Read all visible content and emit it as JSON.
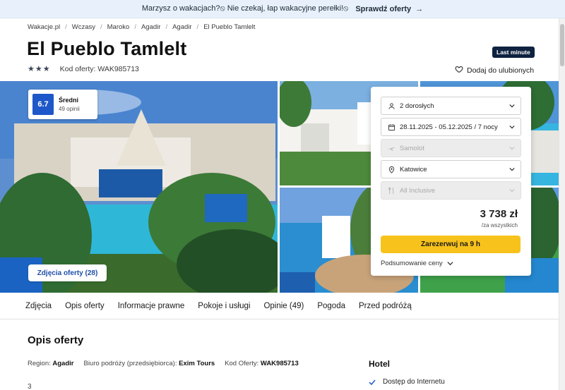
{
  "promo": {
    "text": "Marzysz o wakacjach?⦸ Nie czekaj, łap wakacyjne perełki!⦸",
    "cta": "Sprawdź oferty"
  },
  "breadcrumb": [
    "Wakacje.pl",
    "Wczasy",
    "Maroko",
    "Agadir",
    "Agadir",
    "El Pueblo Tamlelt"
  ],
  "hotel": {
    "name": "El Pueblo Tamlelt",
    "badge": "Last minute",
    "stars": 3,
    "offer_code_label": "Kod oferty: WAK985713",
    "favorite_label": "Dodaj do ulubionych"
  },
  "score": {
    "value": "6.7",
    "label": "Średni",
    "reviews": "49 opinii"
  },
  "photos_button": "Zdjęcia oferty (28)",
  "booking": {
    "travelers": "2 dorosłych",
    "dates": "28.11.2025 - 05.12.2025 / 7 nocy",
    "transport": "Samolot",
    "departure": "Katowice",
    "board": "All Inclusive",
    "price": "3 738 zł",
    "per": "/za wszystkich",
    "book_label": "Zarezerwuj na 9 h",
    "summary_label": "Podsumowanie ceny"
  },
  "tabs": [
    "Zdjęcia",
    "Opis oferty",
    "Informacje prawne",
    "Pokoje i usługi",
    "Opinie (49)",
    "Pogoda",
    "Przed podróżą"
  ],
  "description": {
    "title": "Opis oferty",
    "region_label": "Region:",
    "region_value": "Agadir",
    "operator_label": "Biuro podróży (przedsiębiorca):",
    "operator_value": "Exim Tours",
    "code_label": "Kod Oferty:",
    "code_value": "WAK985713",
    "cut_text": "3"
  },
  "hotel_section": {
    "title": "Hotel",
    "feature": "Dostęp do Internetu"
  },
  "colors": {
    "accent_blue": "#1e57c9",
    "cta_yellow": "#f7c21c",
    "badge_navy": "#0f2240"
  }
}
